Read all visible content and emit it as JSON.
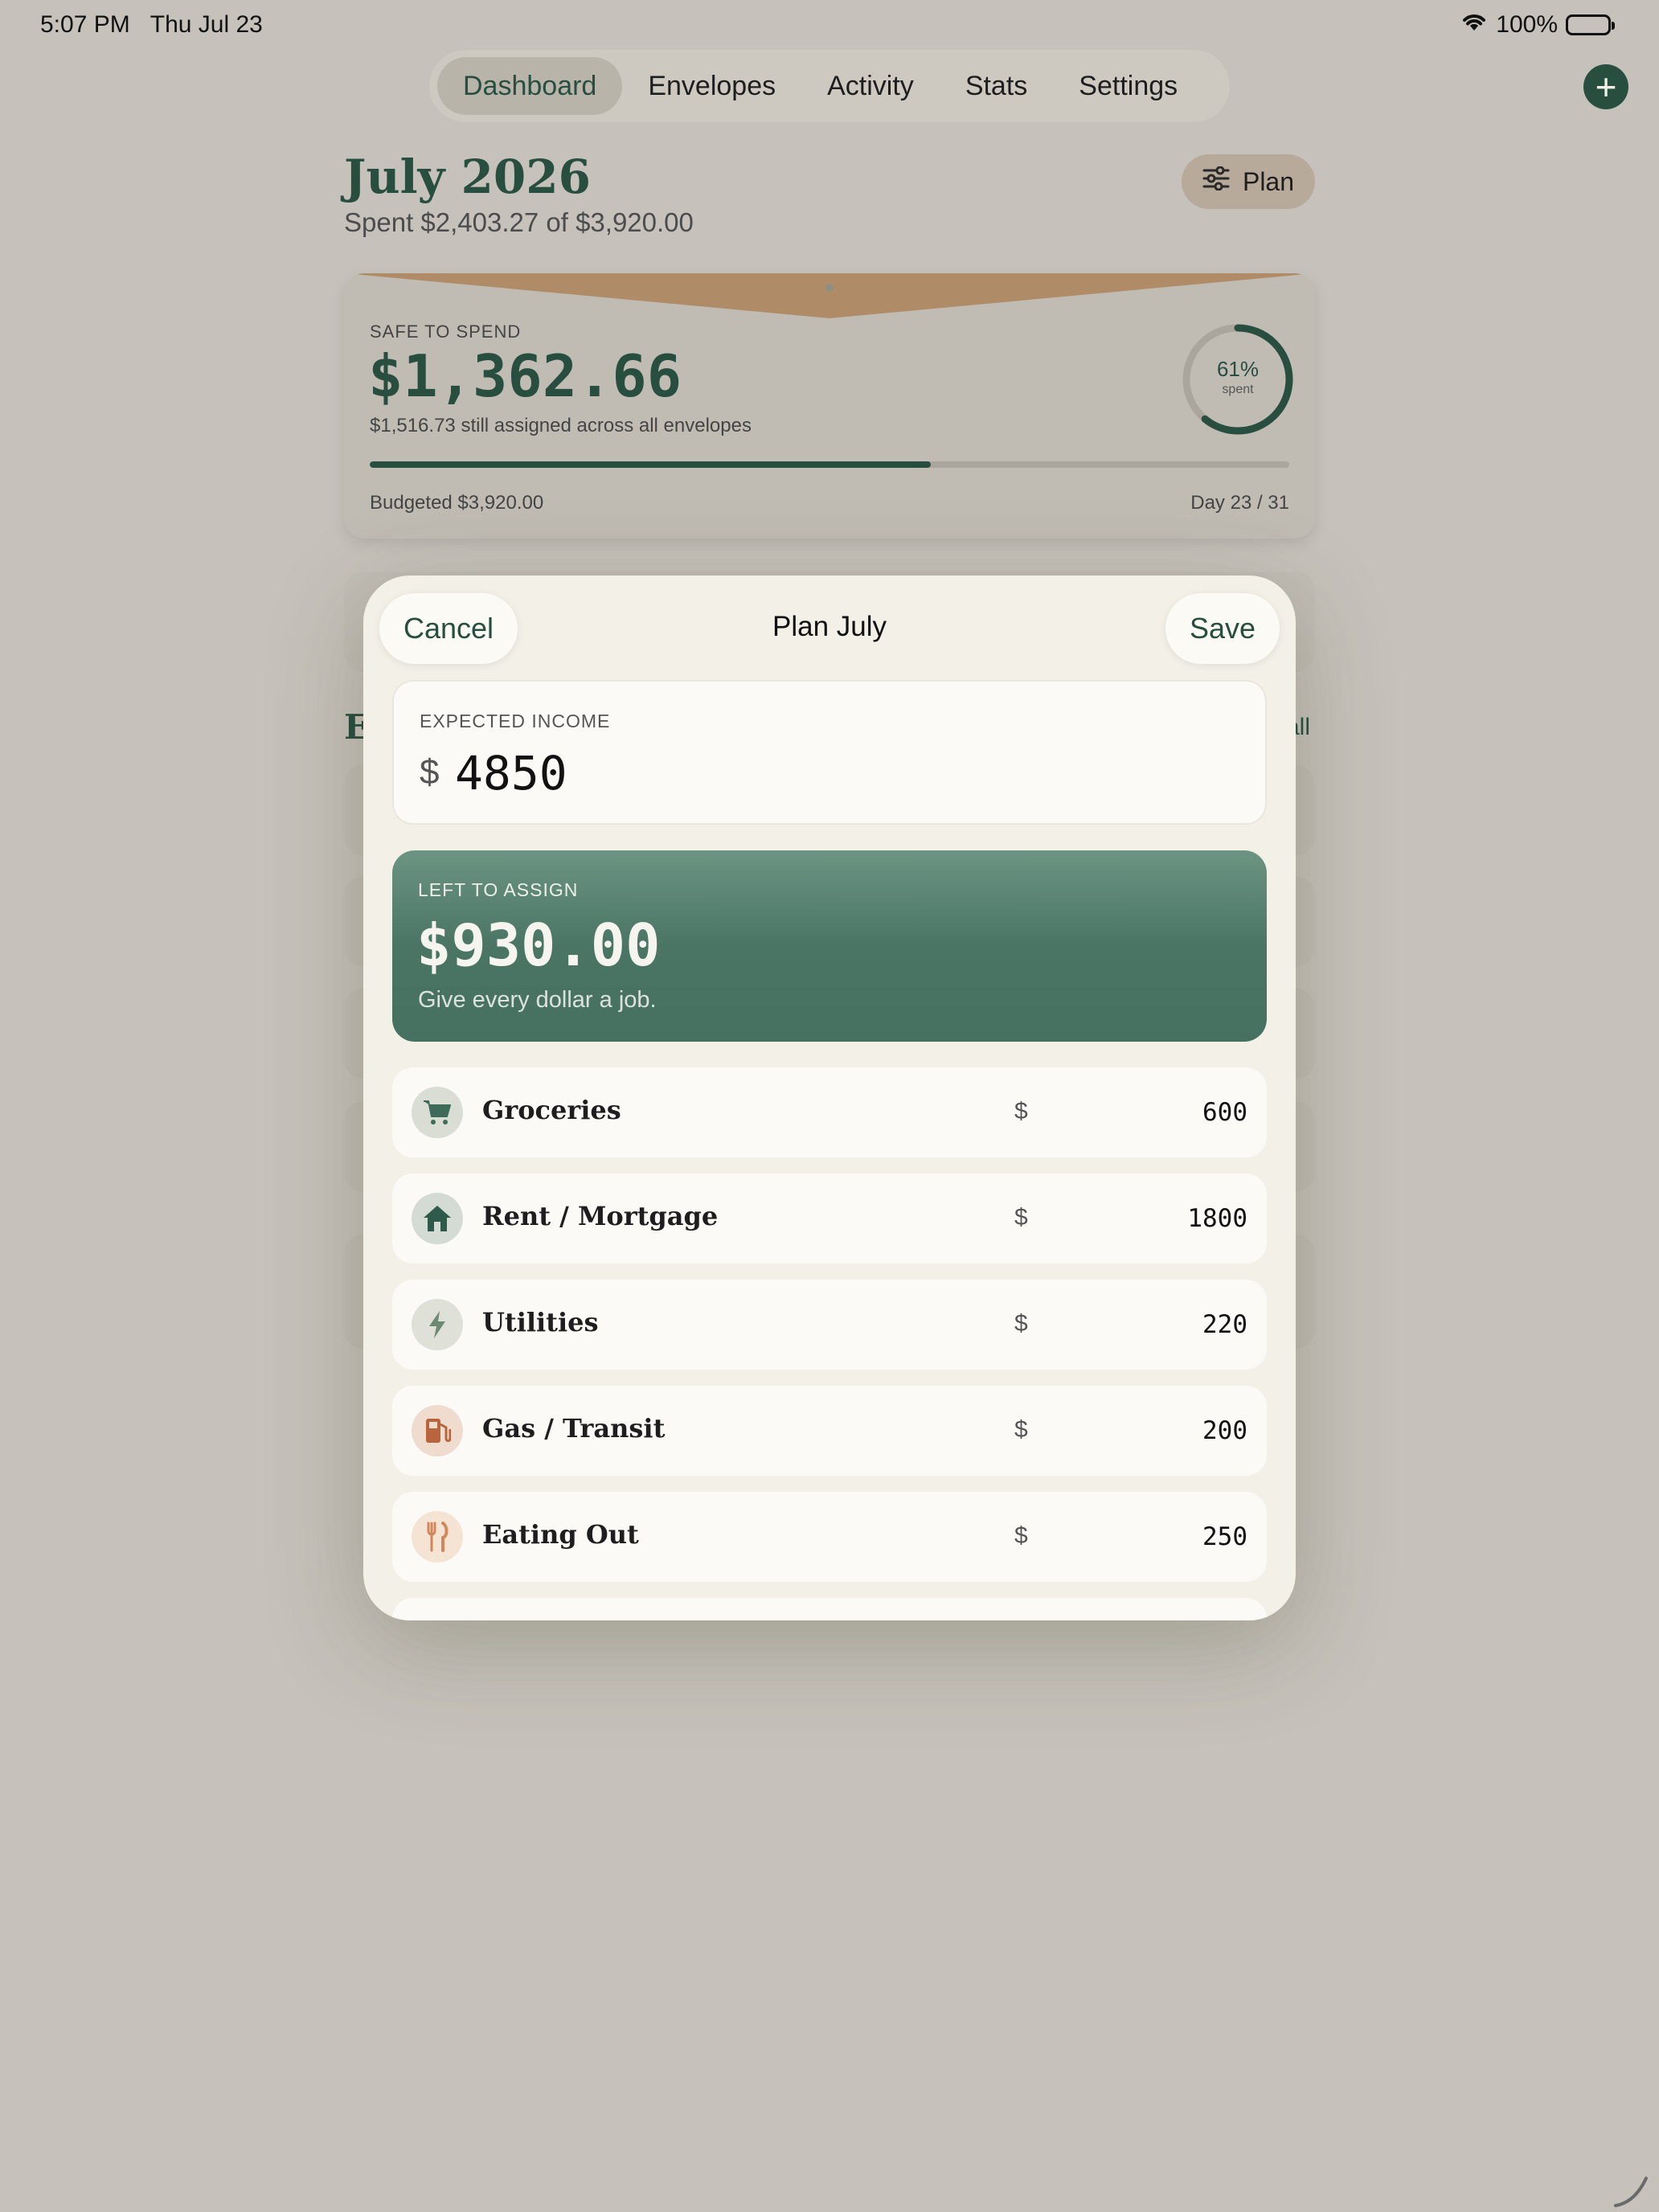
{
  "status": {
    "time": "5:07 PM",
    "date": "Thu Jul 23",
    "battery": "100%"
  },
  "nav": {
    "tabs": [
      {
        "label": "Dashboard",
        "active": true
      },
      {
        "label": "Envelopes"
      },
      {
        "label": "Activity"
      },
      {
        "label": "Stats"
      },
      {
        "label": "Settings"
      }
    ],
    "add_icon": "plus-icon"
  },
  "dashboard": {
    "month_title": "July 2026",
    "spent_summary": "Spent $2,403.27 of $3,920.00",
    "plan_button": "Plan",
    "safe_to_spend": {
      "label": "SAFE TO SPEND",
      "amount": "$1,362.66",
      "assigned_note": "$1,516.73 still assigned across all envelopes",
      "progress_fraction": 0.61,
      "budgeted": "Budgeted $3,920.00",
      "day": "Day 23 / 31",
      "ring_percent": "61%",
      "ring_label": "spent"
    },
    "section_heading_partial": "E",
    "see_all_partial": "all"
  },
  "modal": {
    "title": "Plan July",
    "cancel": "Cancel",
    "save": "Save",
    "income": {
      "label": "EXPECTED INCOME",
      "currency": "$",
      "value": "4850"
    },
    "left_to_assign": {
      "label": "LEFT TO ASSIGN",
      "amount": "$930.00",
      "note": "Give every dollar a job."
    },
    "envelopes": [
      {
        "name": "Groceries",
        "currency": "$",
        "amount": "600",
        "icon": "cart-icon"
      },
      {
        "name": "Rent / Mortgage",
        "currency": "$",
        "amount": "1800",
        "icon": "house-icon"
      },
      {
        "name": "Utilities",
        "currency": "$",
        "amount": "220",
        "icon": "bolt-icon"
      },
      {
        "name": "Gas / Transit",
        "currency": "$",
        "amount": "200",
        "icon": "fuel-pump-icon"
      },
      {
        "name": "Eating Out",
        "currency": "$",
        "amount": "250",
        "icon": "fork-knife-icon"
      }
    ]
  },
  "colors": {
    "accent": "#284e40",
    "envelope_flap": "#b08b68",
    "modal_bg": "#f3f0e8",
    "assign_card": "#4a7565"
  }
}
